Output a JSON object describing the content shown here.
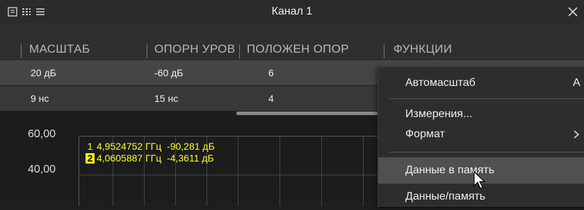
{
  "window": {
    "title": "Канал 1",
    "icons": [
      "single-layout-icon",
      "grid-layout-icon",
      "list-layout-icon"
    ],
    "close_icon": "close-icon"
  },
  "table": {
    "columns": [
      "МАСШТАБ",
      "ОПОРН УРОВ",
      "ПОЛОЖЕН ОПОР",
      "ФУНКЦИИ"
    ],
    "rows": [
      [
        "20 дБ",
        "-60 дБ",
        "6"
      ],
      [
        "9 нс",
        "15 нс",
        "4"
      ]
    ]
  },
  "plot": {
    "y_labels": [
      "60,00",
      "40,00"
    ],
    "markers": [
      {
        "num": "1",
        "freq": "4,9524752 ГГц",
        "value": "-90,281 дБ",
        "active": false
      },
      {
        "num": "2",
        "freq": "4,0605887 ГГц",
        "value": "-4,3611 дБ",
        "active": true
      }
    ]
  },
  "context_menu": {
    "items": [
      {
        "label": "Автомасштаб",
        "shortcut": "A"
      },
      {
        "label": "Измерения..."
      },
      {
        "label": "Формат",
        "submenu_icon": "chevron-right-icon"
      },
      {
        "label": "Данные в память"
      },
      {
        "label": "Данные/память"
      }
    ]
  },
  "colors": {
    "background": "#1e1e1e",
    "marker_text": "#ffff30",
    "marker_active_bg": "#ffff00",
    "menu_highlight": "#505050"
  }
}
